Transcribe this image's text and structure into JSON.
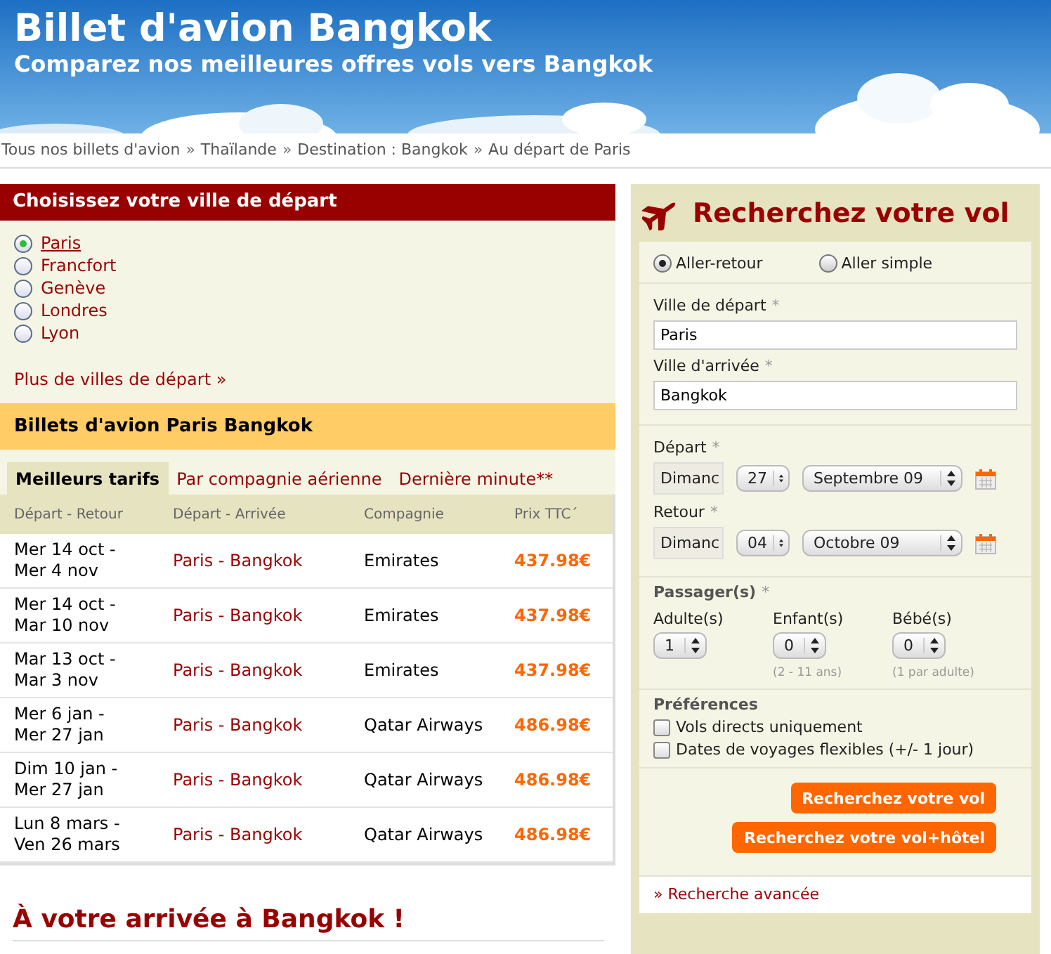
{
  "header": {
    "title": "Billet d'avion Bangkok",
    "subtitle": "Comparez nos meilleures offres vols vers Bangkok"
  },
  "breadcrumb": {
    "separator": "»",
    "items": [
      "Tous nos billets d'avion",
      "Thaïlande",
      "Destination : Bangkok",
      "Au départ de Paris"
    ]
  },
  "departure_cities": {
    "title": "Choisissez votre ville de départ",
    "options": [
      {
        "label": "Paris",
        "selected": true
      },
      {
        "label": "Francfort",
        "selected": false
      },
      {
        "label": "Genève",
        "selected": false
      },
      {
        "label": "Londres",
        "selected": false
      },
      {
        "label": "Lyon",
        "selected": false
      }
    ],
    "more_link": "Plus de villes de départ »"
  },
  "fares": {
    "title": "Billets d'avion Paris Bangkok",
    "tabs": [
      {
        "label": "Meilleurs tarifs",
        "selected": true
      },
      {
        "label": "Par compagnie aérienne",
        "selected": false
      },
      {
        "label": "Dernière minute**",
        "selected": false
      }
    ],
    "columns": [
      "Départ - Retour",
      "Départ - Arrivée",
      "Compagnie",
      "Prix TTC´"
    ],
    "rows": [
      {
        "dates": [
          "Mer 14 oct -",
          "Mer 4 nov"
        ],
        "route": "Paris - Bangkok",
        "airline": "Emirates",
        "price": "437.98€"
      },
      {
        "dates": [
          "Mer 14 oct -",
          "Mar 10 nov"
        ],
        "route": "Paris - Bangkok",
        "airline": "Emirates",
        "price": "437.98€"
      },
      {
        "dates": [
          "Mar 13 oct -",
          "Mar 3 nov"
        ],
        "route": "Paris - Bangkok",
        "airline": "Emirates",
        "price": "437.98€"
      },
      {
        "dates": [
          "Mer 6 jan -",
          "Mer 27 jan"
        ],
        "route": "Paris - Bangkok",
        "airline": "Qatar Airways",
        "price": "486.98€"
      },
      {
        "dates": [
          "Dim 10 jan -",
          "Mer 27 jan"
        ],
        "route": "Paris - Bangkok",
        "airline": "Qatar Airways",
        "price": "486.98€"
      },
      {
        "dates": [
          "Lun 8 mars -",
          "Ven 26 mars"
        ],
        "route": "Paris - Bangkok",
        "airline": "Qatar Airways",
        "price": "486.98€"
      }
    ]
  },
  "arrival_heading": "À votre arrivée à Bangkok !",
  "search": {
    "title": "Recherchez votre vol",
    "trip_types": [
      {
        "label": "Aller-retour",
        "selected": true
      },
      {
        "label": "Aller simple",
        "selected": false
      }
    ],
    "cities": [
      {
        "label": "Ville de départ",
        "required": "*",
        "value": "Paris"
      },
      {
        "label": "Ville d'arrivée",
        "required": "*",
        "value": "Bangkok"
      }
    ],
    "dates": [
      {
        "label": "Départ",
        "required": "*",
        "weekday": "Dimanc",
        "day": "27",
        "month": "Septembre 09"
      },
      {
        "label": "Retour",
        "required": "*",
        "weekday": "Dimanc",
        "day": "04",
        "month": "Octobre 09"
      }
    ],
    "passengers": {
      "title": "Passager(s)",
      "required": "*",
      "groups": [
        {
          "label": "Adulte(s)",
          "value": "1"
        },
        {
          "label": "Enfant(s)",
          "value": "0",
          "note": "(2 - 11 ans)"
        },
        {
          "label": "Bébé(s)",
          "value": "0",
          "note": "(1 par adulte)"
        }
      ]
    },
    "preferences": {
      "title": "Préférences",
      "options": [
        {
          "label": "Vols directs uniquement",
          "checked": false
        },
        {
          "label": "Dates de voyages flexibles (+/- 1 jour)",
          "checked": false
        }
      ]
    },
    "buttons": [
      "Recherchez votre vol",
      "Recherchez votre vol+hôtel"
    ],
    "advanced_link": "» Recherche avancée"
  }
}
